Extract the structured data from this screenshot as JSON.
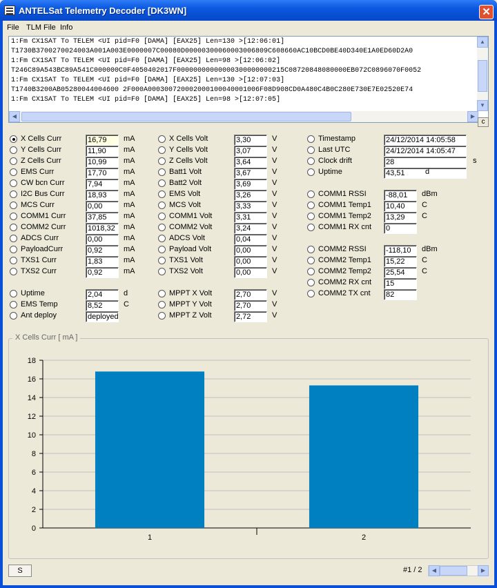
{
  "window": {
    "title": "ANTELSat Telemetry Decoder [DK3WN]",
    "close": "✕"
  },
  "menu": [
    "File",
    "TLM File",
    "Info"
  ],
  "log": [
    "1:Fm CX1SAT To TELEM <UI pid=F0 [DAMA] [EAX25] Len=130 >[12:06:01]",
    "T1730B3700270024003A001A003E0000007C00080D00000300060003006809C608660AC10BCD0BE40D340E1A0ED60D2A0",
    "1:Fm CX1SAT To TELEM <UI pid=F0 [DAMA] [EAX25] Len=98 >[12:06:02]",
    "T246C89A543BC89A541C000000C0F4050402017F00000000000000300000000215C08720848080000EB072C0896070F0052",
    "1:Fm CX1SAT To TELEM <UI pid=F0 [DAMA] [EAX25] Len=130 >[12:07:03]",
    "T1740B3200AB05280044004600 2F000A000300720002000100040001006F08D908CD0A480C4B0C280E730E7E02520E74",
    "1:Fm CX1SAT To TELEM <UI pid=F0 [DAMA] [EAX25] Len=98 >[12:07:05]"
  ],
  "corner_btn": "c",
  "col1": [
    {
      "label": "X Cells Curr",
      "value": "16,79",
      "unit": "mA",
      "selected": true
    },
    {
      "label": "Y Cells Curr",
      "value": "11,90",
      "unit": "mA"
    },
    {
      "label": "Z Cells Curr",
      "value": "10,99",
      "unit": "mA"
    },
    {
      "label": "EMS Curr",
      "value": "17,70",
      "unit": "mA"
    },
    {
      "label": "CW bcn Curr",
      "value": "7,94",
      "unit": "mA"
    },
    {
      "label": "I2C Bus Curr",
      "value": "18,93",
      "unit": "mA"
    },
    {
      "label": "MCS Curr",
      "value": "0,00",
      "unit": "mA"
    },
    {
      "label": "COMM1 Curr",
      "value": "37,85",
      "unit": "mA"
    },
    {
      "label": "COMM2 Curr",
      "value": "1018,32",
      "unit": "mA"
    },
    {
      "label": "ADCS Curr",
      "value": "0,00",
      "unit": "mA"
    },
    {
      "label": "PayloadCurr",
      "value": "0,92",
      "unit": "mA"
    },
    {
      "label": "TXS1 Curr",
      "value": "1,83",
      "unit": "mA"
    },
    {
      "label": "TXS2 Curr",
      "value": "0,92",
      "unit": "mA"
    }
  ],
  "col1b": [
    {
      "label": "Uptime",
      "value": "2,04",
      "unit": "d"
    },
    {
      "label": "EMS Temp",
      "value": "8,52",
      "unit": "C"
    },
    {
      "label": "Ant deploy",
      "value": "deployed",
      "unit": ""
    }
  ],
  "col2": [
    {
      "label": "X Cells Volt",
      "value": "3,30",
      "unit": "V"
    },
    {
      "label": "Y Cells Volt",
      "value": "3,07",
      "unit": "V"
    },
    {
      "label": "Z Cells Volt",
      "value": "3,64",
      "unit": "V"
    },
    {
      "label": "Batt1 Volt",
      "value": "3,67",
      "unit": "V"
    },
    {
      "label": "Batt2 Volt",
      "value": "3,69",
      "unit": "V"
    },
    {
      "label": "EMS Volt",
      "value": "3,26",
      "unit": "V"
    },
    {
      "label": "MCS Volt",
      "value": "3,33",
      "unit": "V"
    },
    {
      "label": "COMM1 Volt",
      "value": "3,31",
      "unit": "V"
    },
    {
      "label": "COMM2 Volt",
      "value": "3,24",
      "unit": "V"
    },
    {
      "label": "ADCS Volt",
      "value": "0,04",
      "unit": "V"
    },
    {
      "label": "Payload Volt",
      "value": "0,00",
      "unit": "V"
    },
    {
      "label": "TXS1 Volt",
      "value": "0,00",
      "unit": "V"
    },
    {
      "label": "TXS2 Volt",
      "value": "0,00",
      "unit": "V"
    }
  ],
  "col2b": [
    {
      "label": "MPPT X Volt",
      "value": "2,70",
      "unit": "V"
    },
    {
      "label": "MPPT Y Volt",
      "value": "2,70",
      "unit": "V"
    },
    {
      "label": "MPPT Z Volt",
      "value": "2,72",
      "unit": "V"
    }
  ],
  "col3": [
    {
      "label": "Timestamp",
      "value": "24/12/2014 14:05:58",
      "unit": ""
    },
    {
      "label": "Last UTC",
      "value": "24/12/2014 14:05:47",
      "unit": ""
    },
    {
      "label": "Clock drift",
      "value": "28",
      "unit": "s"
    },
    {
      "label": "Uptime",
      "value": "43,51",
      "unit": "d"
    }
  ],
  "col3b": [
    {
      "label": "COMM1 RSSI",
      "value": "-88,01",
      "unit": "dBm"
    },
    {
      "label": "COMM1 Temp1",
      "value": "10,40",
      "unit": "C"
    },
    {
      "label": "COMM1 Temp2",
      "value": "13,29",
      "unit": "C"
    },
    {
      "label": "COMM1 RX cnt",
      "value": "0",
      "unit": ""
    }
  ],
  "col3c": [
    {
      "label": "COMM2 RSSI",
      "value": "-118,10",
      "unit": "dBm"
    },
    {
      "label": "COMM2 Temp1",
      "value": "15,22",
      "unit": "C"
    },
    {
      "label": "COMM2 Temp2",
      "value": "25,54",
      "unit": "C"
    },
    {
      "label": "COMM2 RX cnt",
      "value": "15",
      "unit": ""
    },
    {
      "label": "COMM2 TX cnt",
      "value": "82",
      "unit": ""
    }
  ],
  "chart_data": {
    "type": "bar",
    "title": "X Cells Curr  [ mA ]",
    "categories": [
      "1",
      "2"
    ],
    "values": [
      16.79,
      15.3
    ],
    "ylim": [
      0,
      18
    ],
    "yticks": [
      0,
      2,
      4,
      6,
      8,
      10,
      12,
      14,
      16,
      18
    ],
    "bar_color": "#0080c0",
    "grid": true
  },
  "bottom": {
    "s_button": "S",
    "page": "#1 / 2"
  }
}
